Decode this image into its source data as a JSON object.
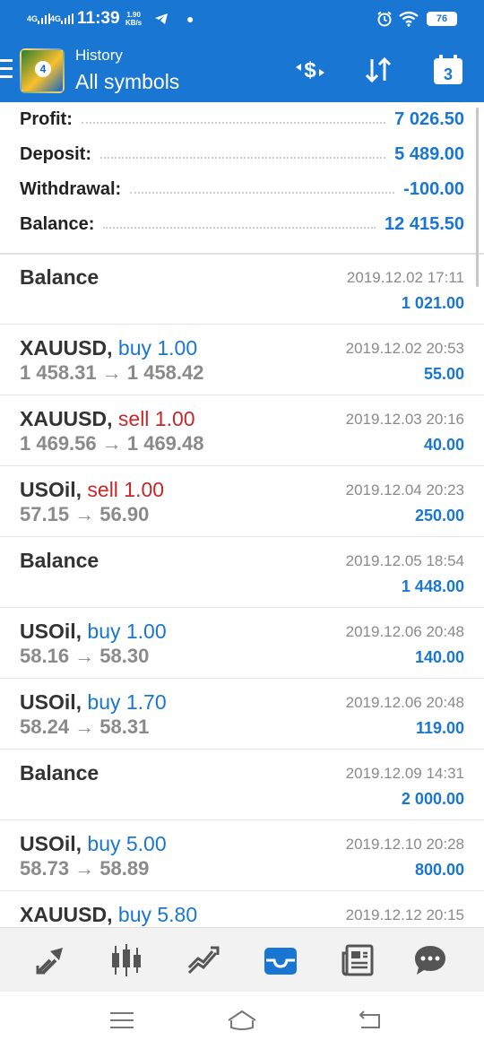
{
  "status_bar": {
    "net1": "4G",
    "net2": "4G",
    "time": "11:39",
    "speed_value": "1.90",
    "speed_unit": "KB/s",
    "battery": "76"
  },
  "toolbar": {
    "subtitle": "History",
    "title": "All symbols",
    "calendar_day": "3"
  },
  "summary": {
    "profit_label": "Profit:",
    "profit_value": "7 026.50",
    "deposit_label": "Deposit:",
    "deposit_value": "5 489.00",
    "withdrawal_label": "Withdrawal:",
    "withdrawal_value": "-100.00",
    "balance_label": "Balance:",
    "balance_value": "12 415.50"
  },
  "history": [
    {
      "symbol": "Balance",
      "side": "",
      "side_text": "",
      "prices": "",
      "date": "2019.12.02 17:11",
      "profit": "1 021.00"
    },
    {
      "symbol": "XAUUSD,",
      "side": "buy",
      "side_text": "buy 1.00",
      "prices": "1 458.31 → 1 458.42",
      "date": "2019.12.02 20:53",
      "profit": "55.00"
    },
    {
      "symbol": "XAUUSD,",
      "side": "sell",
      "side_text": "sell 1.00",
      "prices": "1 469.56 → 1 469.48",
      "date": "2019.12.03 20:16",
      "profit": "40.00"
    },
    {
      "symbol": "USOil,",
      "side": "sell",
      "side_text": "sell 1.00",
      "prices": "57.15 → 56.90",
      "date": "2019.12.04 20:23",
      "profit": "250.00"
    },
    {
      "symbol": "Balance",
      "side": "",
      "side_text": "",
      "prices": "",
      "date": "2019.12.05 18:54",
      "profit": "1 448.00"
    },
    {
      "symbol": "USOil,",
      "side": "buy",
      "side_text": "buy 1.00",
      "prices": "58.16 → 58.30",
      "date": "2019.12.06 20:48",
      "profit": "140.00"
    },
    {
      "symbol": "USOil,",
      "side": "buy",
      "side_text": "buy 1.70",
      "prices": "58.24 → 58.31",
      "date": "2019.12.06 20:48",
      "profit": "119.00"
    },
    {
      "symbol": "Balance",
      "side": "",
      "side_text": "",
      "prices": "",
      "date": "2019.12.09 14:31",
      "profit": "2 000.00"
    },
    {
      "symbol": "USOil,",
      "side": "buy",
      "side_text": "buy 5.00",
      "prices": "58.73 → 58.89",
      "date": "2019.12.10 20:28",
      "profit": "800.00"
    },
    {
      "symbol": "XAUUSD,",
      "side": "buy",
      "side_text": "buy 5.80",
      "prices": "",
      "date": "2019.12.12 20:15",
      "profit": ""
    }
  ],
  "bottom_nav": [
    {
      "name": "nav-quotes",
      "icon": "quotes-arrows-icon",
      "active": false
    },
    {
      "name": "nav-chart",
      "icon": "candlestick-icon",
      "active": false
    },
    {
      "name": "nav-trade",
      "icon": "trade-trend-icon",
      "active": false
    },
    {
      "name": "nav-history",
      "icon": "inbox-tray-icon",
      "active": true
    },
    {
      "name": "nav-news",
      "icon": "newspaper-icon",
      "active": false
    },
    {
      "name": "nav-chat",
      "icon": "chat-bubble-icon",
      "active": false
    }
  ],
  "colors": {
    "accent": "#1976d2",
    "sell": "#c62828",
    "muted": "#8a8a8a",
    "nav_inactive": "#555555"
  }
}
